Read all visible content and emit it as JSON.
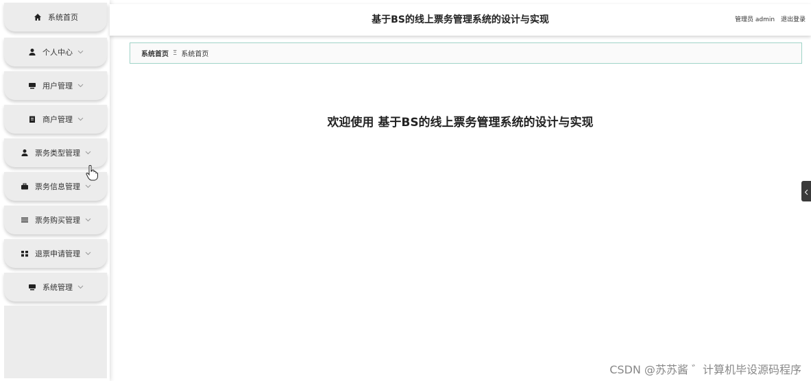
{
  "sidebar": {
    "items": [
      {
        "label": "系统首页",
        "icon": "home-icon",
        "has_chevron": false
      },
      {
        "label": "个人中心",
        "icon": "user-icon",
        "has_chevron": true
      },
      {
        "label": "用户管理",
        "icon": "monitor-icon",
        "has_chevron": true
      },
      {
        "label": "商户管理",
        "icon": "clipboard-icon",
        "has_chevron": true
      },
      {
        "label": "票务类型管理",
        "icon": "user-icon",
        "has_chevron": true
      },
      {
        "label": "票务信息管理",
        "icon": "briefcase-icon",
        "has_chevron": true
      },
      {
        "label": "票务购买管理",
        "icon": "list-icon",
        "has_chevron": true
      },
      {
        "label": "退票申请管理",
        "icon": "grid-icon",
        "has_chevron": true
      },
      {
        "label": "系统管理",
        "icon": "monitor-icon",
        "has_chevron": true
      }
    ]
  },
  "header": {
    "title": "基于BS的线上票务管理系统的设计与实现",
    "user_label": "管理员 admin",
    "logout_label": "退出登录"
  },
  "breadcrumb": {
    "home": "系统首页",
    "separator": "Ξ",
    "current": "系统首页"
  },
  "main": {
    "welcome_text": "欢迎使用 基于BS的线上票务管理系统的设计与实现"
  },
  "watermark": {
    "text": "CSDN @苏苏酱   ゛计算机毕设源码程序"
  },
  "colors": {
    "menu_bg": "#ececec",
    "breadcrumb_border": "#9fd3c7",
    "handle_bg": "#3a3a3a"
  }
}
